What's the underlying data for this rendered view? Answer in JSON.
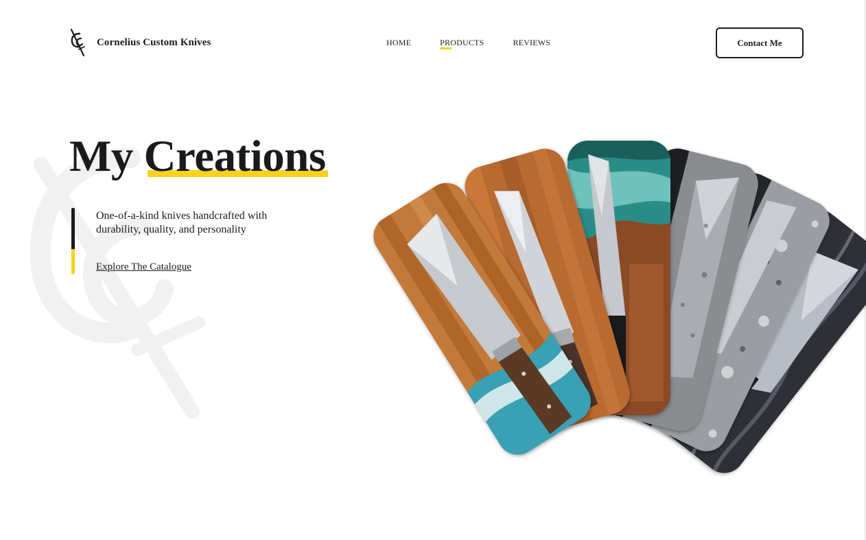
{
  "header": {
    "brand": "Cornelius Custom Knives",
    "logo_icon": "cc-monogram-icon",
    "nav": [
      {
        "label": "HOME",
        "active": false
      },
      {
        "label": "PRODUCTS",
        "active": true
      },
      {
        "label": "REVIEWS",
        "active": false
      }
    ],
    "contact_label": "Contact Me"
  },
  "hero": {
    "title_plain": "My",
    "title_highlight": "Creations",
    "tagline": "One-of-a-kind knives handcrafted with durability, quality, and personality",
    "cta_label": "Explore The Catalogue"
  },
  "gallery": {
    "cards": [
      {
        "name": "knife-photo-wood-resin"
      },
      {
        "name": "knife-photo-two-on-wood"
      },
      {
        "name": "knife-photo-teal-resin"
      },
      {
        "name": "knife-photo-dark-stone"
      },
      {
        "name": "knife-photo-gray-granite"
      },
      {
        "name": "knife-photo-damascus"
      }
    ]
  },
  "colors": {
    "accent": "#fbd11c",
    "text": "#1b1b1b",
    "background": "#ffffff"
  }
}
